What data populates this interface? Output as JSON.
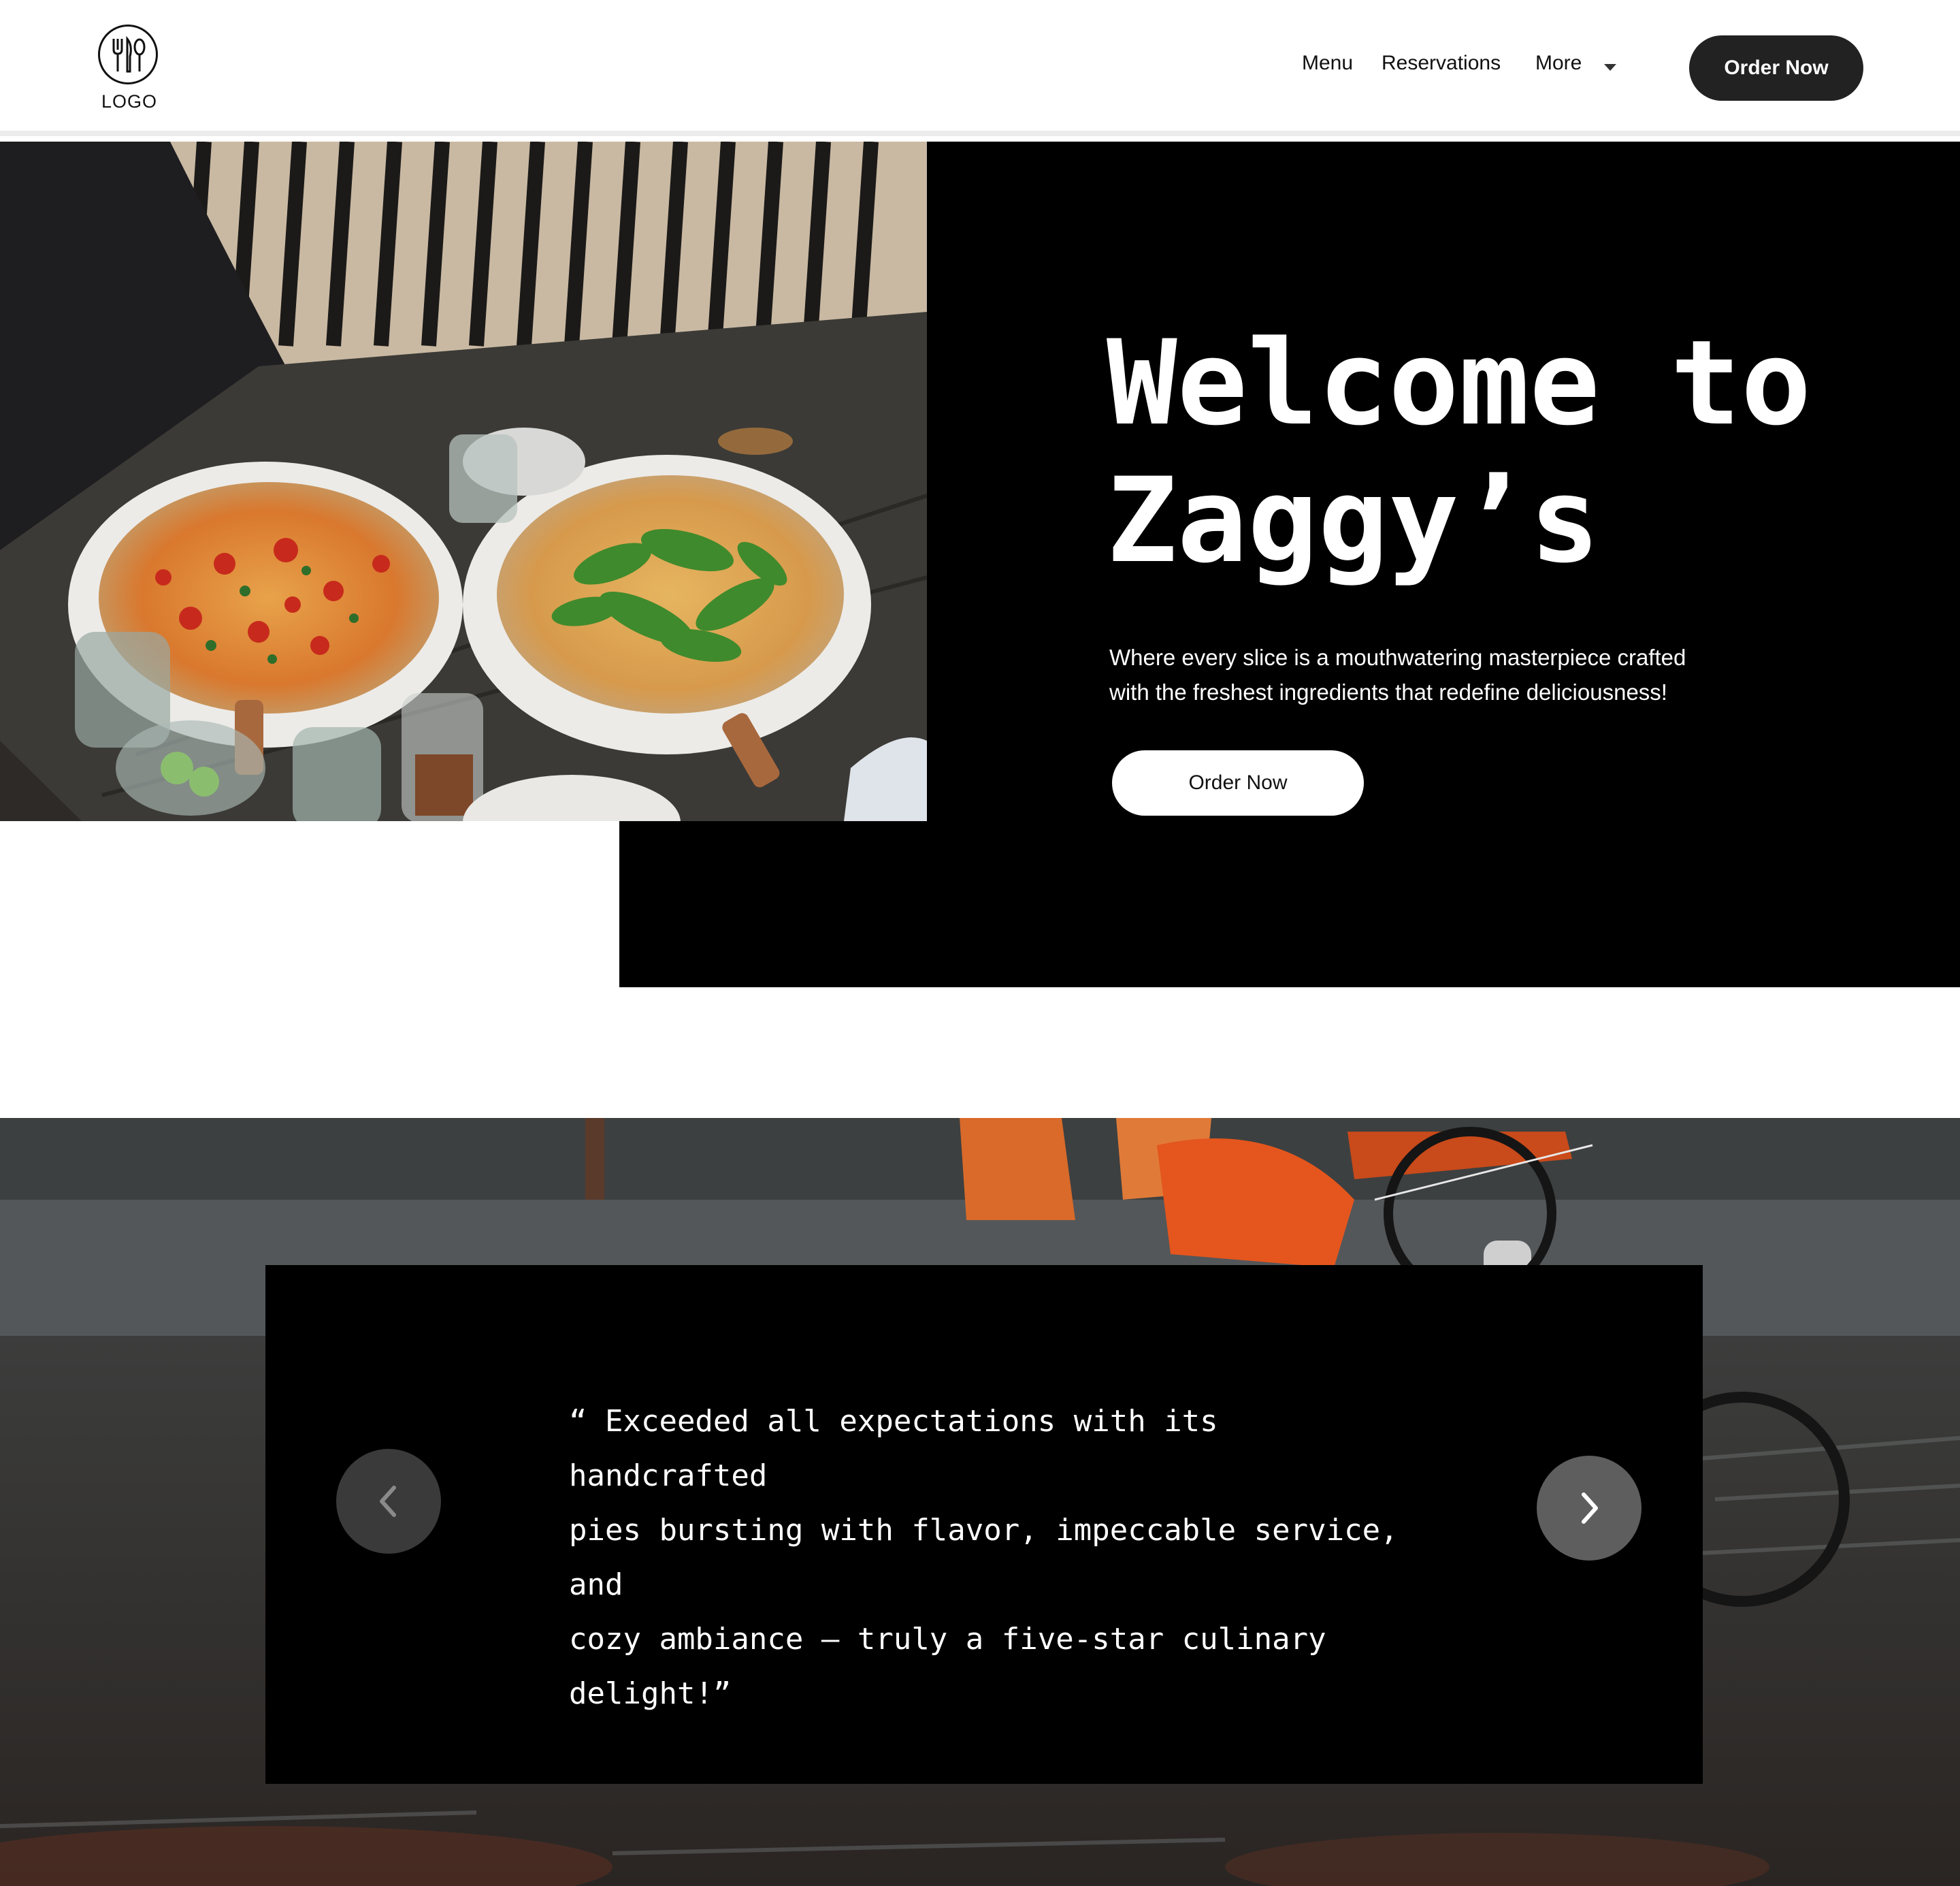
{
  "header": {
    "logo_text": "LOGO",
    "nav": {
      "menu": "Menu",
      "reservations": "Reservations",
      "more": "More"
    },
    "order_button": "Order Now"
  },
  "hero": {
    "title_line1": "Welcome to",
    "title_line2": "Zaggy’s",
    "subtitle_line1": "Where every slice is a mouthwatering masterpiece crafted",
    "subtitle_line2": "with the freshest ingredients that redefine deliciousness!",
    "order_button": "Order Now",
    "photo_icon": "pizza-photo"
  },
  "testimonial": {
    "quote_line1": "“ Exceeded all expectations with its handcrafted",
    "quote_line2": "pies bursting with flavor, impeccable service, and",
    "quote_line3": "cozy ambiance — truly a five-star culinary",
    "quote_line4": "delight!”",
    "prev_icon": "chevron-left-icon",
    "next_icon": "chevron-right-icon",
    "background_icon": "delivery-cyclist-photo"
  },
  "colors": {
    "hero_bg": "#000000",
    "button_dark": "#222222",
    "delivery_orange": "#e4561d"
  }
}
